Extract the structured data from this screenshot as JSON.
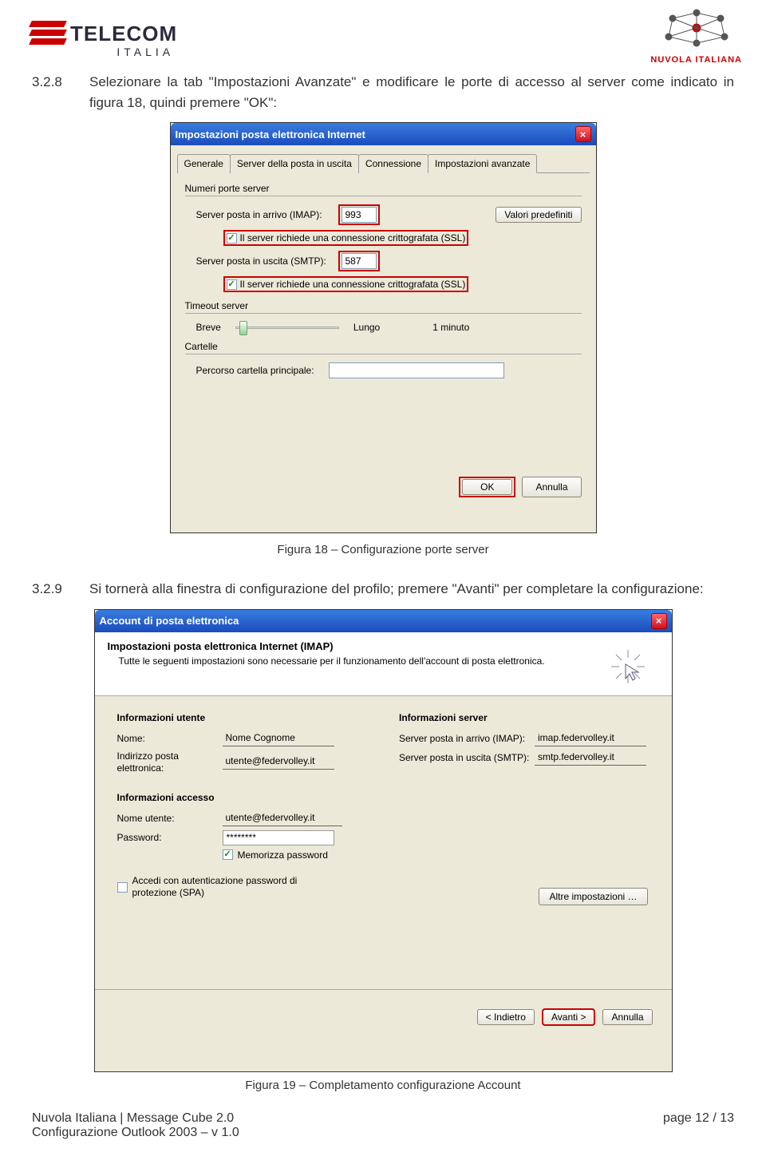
{
  "header": {
    "telecom_name": "TELECOM",
    "telecom_sub": "ITALIA",
    "nuvola_label": "NUVOLA ITALIANA"
  },
  "section1": {
    "num": "3.2.8",
    "text": "Selezionare la tab \"Impostazioni Avanzate\" e modificare le porte di accesso al server come indicato in figura 18, quindi premere \"OK\":"
  },
  "dlg1": {
    "title": "Impostazioni posta elettronica Internet",
    "tabs": [
      "Generale",
      "Server della posta in uscita",
      "Connessione",
      "Impostazioni avanzate"
    ],
    "group_ports": "Numeri porte server",
    "imap_label": "Server posta in arrivo (IMAP):",
    "imap_port": "993",
    "defaults_btn": "Valori predefiniti",
    "ssl1": "Il server richiede una connessione crittografata (SSL)",
    "smtp_label": "Server posta in uscita (SMTP):",
    "smtp_port": "587",
    "ssl2": "Il server richiede una connessione crittografata (SSL)",
    "group_timeout": "Timeout server",
    "breve": "Breve",
    "lungo": "Lungo",
    "minuto": "1 minuto",
    "group_folders": "Cartelle",
    "folder_label": "Percorso cartella principale:",
    "ok": "OK",
    "cancel": "Annulla"
  },
  "caption1": "Figura 18 – Configurazione porte server",
  "section2": {
    "num": "3.2.9",
    "text": "Si tornerà alla finestra di configurazione del profilo; premere \"Avanti\" per completare la configurazione:"
  },
  "dlg2": {
    "title": "Account di posta elettronica",
    "head_title": "Impostazioni posta elettronica Internet (IMAP)",
    "head_desc": "Tutte le seguenti impostazioni sono necessarie per il funzionamento dell'account di posta elettronica.",
    "grp_user": "Informazioni utente",
    "name_label": "Nome:",
    "name_value": "Nome Cognome",
    "email_label": "Indirizzo posta elettronica:",
    "email_value": "utente@federvolley.it",
    "grp_server": "Informazioni server",
    "in_label": "Server posta in arrivo (IMAP):",
    "in_value": "imap.federvolley.it",
    "out_label": "Server posta in uscita (SMTP):",
    "out_value": "smtp.federvolley.it",
    "grp_access": "Informazioni accesso",
    "user_label": "Nome utente:",
    "user_value": "utente@federvolley.it",
    "pass_label": "Password:",
    "pass_value": "********",
    "remember": "Memorizza password",
    "spa": "Accedi con autenticazione password di protezione (SPA)",
    "more": "Altre impostazioni …",
    "back": "< Indietro",
    "next": "Avanti >",
    "cancel": "Annulla"
  },
  "caption2": "Figura 19 – Completamento configurazione Account",
  "footer": {
    "left1": "Nuvola Italiana | Message Cube 2.0",
    "left2": "Configurazione Outlook 2003 – v 1.0",
    "right": "page 12 / 13"
  }
}
